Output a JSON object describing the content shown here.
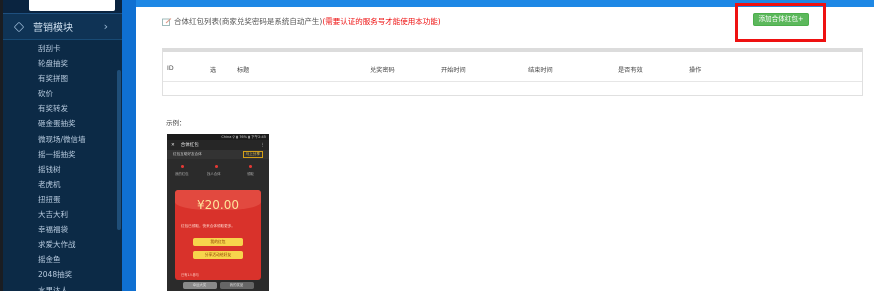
{
  "sidebar": {
    "menu_head": "营销模块",
    "chevron": "›",
    "items": [
      "刮刮卡",
      "轮盘抽奖",
      "有奖拼图",
      "砍价",
      "有奖转发",
      "砸金蛋抽奖",
      "微现场/微信墙",
      "摇一摇抽奖",
      "摇钱树",
      "老虎机",
      "扭扭蛋",
      "大吉大利",
      "幸福福袋",
      "求爱大作战",
      "摇金鱼",
      "2048抽奖",
      "水果达人"
    ]
  },
  "header": {
    "list_title": "合体红包列表",
    "list_note_gray": "(商家兑奖密码是系统自动产生)",
    "list_note_red": "(需要认证的服务号才能使用本功能)",
    "add_button": "添加合体红包+"
  },
  "table": {
    "columns": [
      "ID",
      "选",
      "标题",
      "兑奖密码",
      "开始时间",
      "结束时间",
      "是否有效",
      "操作"
    ]
  },
  "example": {
    "label": "示例：",
    "phone": {
      "status": "China ⚲ ▮ 76% ▮ 下午2:45",
      "title": "合体红包",
      "close": "✕",
      "more": "⋮",
      "sub_text": "红包互助好友合体",
      "share_btn": "马上分享",
      "steps": [
        "我的红包",
        "找人合体",
        "领取"
      ],
      "amount": "¥20.00",
      "env_text": "红包已领取，快来合体领取更多。",
      "btn1": "我的红包",
      "btn2": "分享活动给好友",
      "footer": "已有1人参与",
      "tab_left": "幸运大奖",
      "tab_right": "我的奖品"
    }
  },
  "colors": {
    "sidebar_bg": "#0c2a46",
    "accent_blue": "#1e88e5",
    "button_green": "#5cb85c",
    "highlight_red": "#ee1111"
  }
}
